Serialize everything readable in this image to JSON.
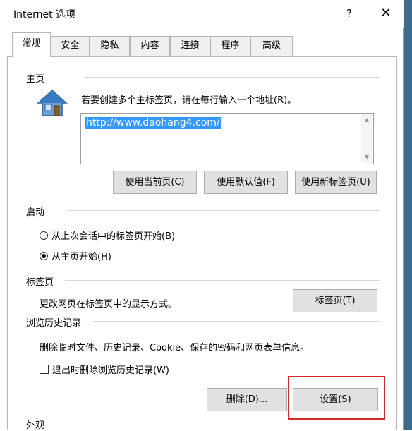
{
  "window": {
    "title": "Internet 选项",
    "help_glyph": "?",
    "close_glyph": "✕"
  },
  "tabs": [
    {
      "label": "常规",
      "active": true
    },
    {
      "label": "安全"
    },
    {
      "label": "隐私"
    },
    {
      "label": "内容"
    },
    {
      "label": "连接"
    },
    {
      "label": "程序"
    },
    {
      "label": "高级"
    }
  ],
  "homepage": {
    "group_label": "主页",
    "instruction": "若要创建多个主标签页，请在每行输入一个地址(R)。",
    "url_value": "http://www.daohang4.com/",
    "buttons": {
      "use_current": "使用当前页(C)",
      "use_default": "使用默认值(F)",
      "use_new_tab": "使用新标签页(U)"
    }
  },
  "startup": {
    "group_label": "启动",
    "options": [
      {
        "label": "从上次会话中的标签页开始(B)",
        "selected": false
      },
      {
        "label": "从主页开始(H)",
        "selected": true
      }
    ]
  },
  "tabs_section": {
    "group_label": "标签页",
    "description": "更改网页在标签页中的显示方式。",
    "button": "标签页(T)"
  },
  "history": {
    "group_label": "浏览历史记录",
    "description": "删除临时文件、历史记录、Cookie、保存的密码和网页表单信息。",
    "checkbox_label": "退出时删除浏览历史记录(W)",
    "checkbox_checked": false,
    "buttons": {
      "delete": "删除(D)...",
      "settings": "设置(S)"
    }
  },
  "appearance": {
    "group_label": "外观"
  },
  "colors": {
    "highlight": "#d42a2a",
    "selection": "#3399ff"
  }
}
